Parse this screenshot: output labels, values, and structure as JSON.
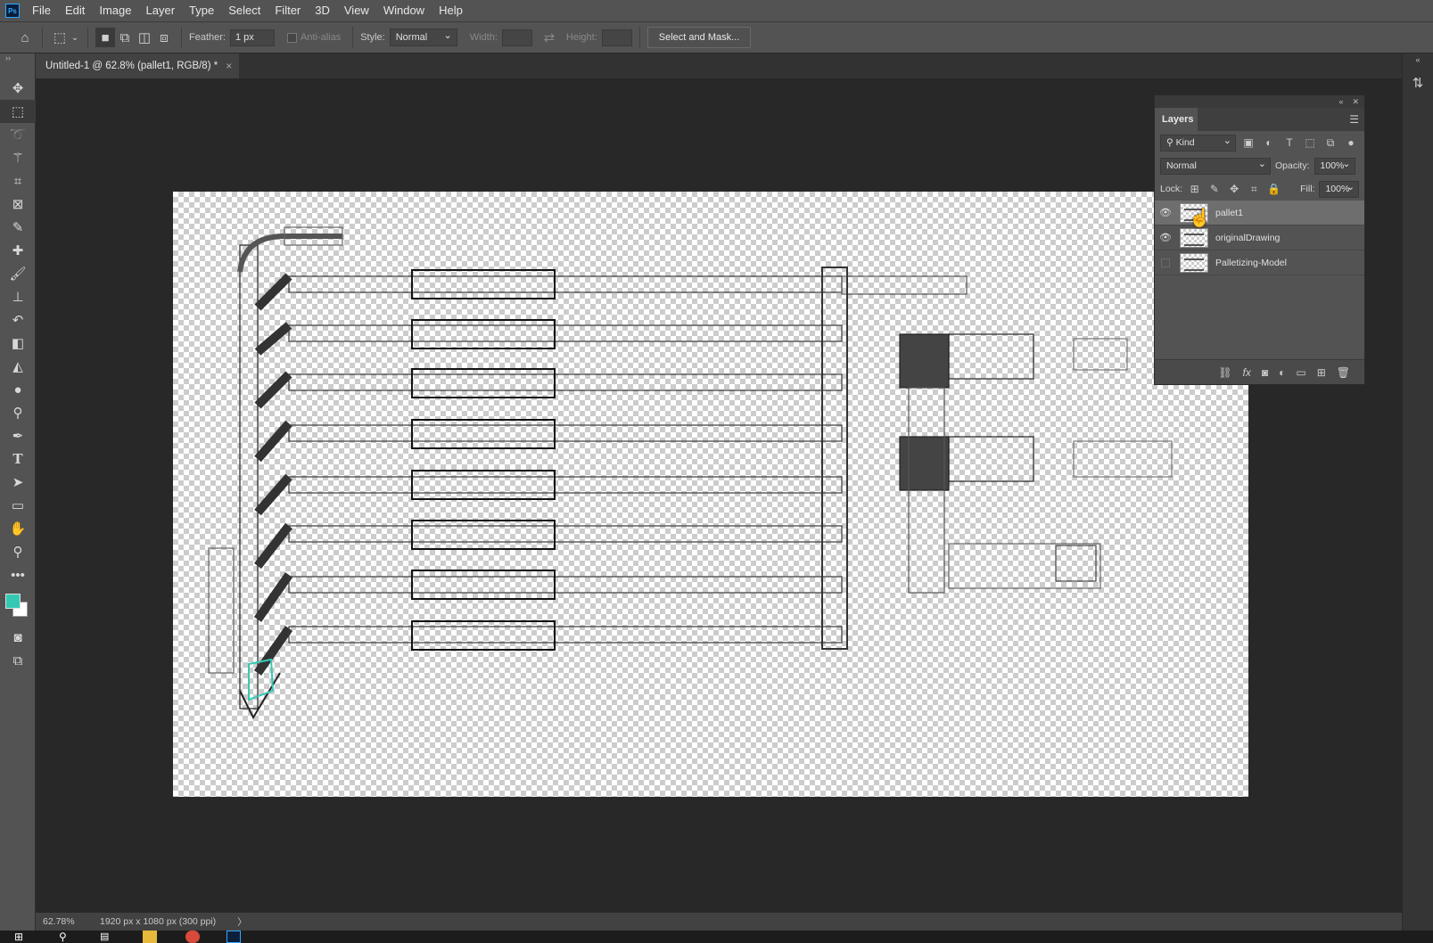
{
  "menubar": {
    "items": [
      "File",
      "Edit",
      "Image",
      "Layer",
      "Type",
      "Select",
      "Filter",
      "3D",
      "View",
      "Window",
      "Help"
    ]
  },
  "options": {
    "feather_label": "Feather:",
    "feather_value": "1 px",
    "antialias_label": "Anti-alias",
    "style_label": "Style:",
    "style_value": "Normal",
    "width_label": "Width:",
    "height_label": "Height:",
    "select_mask_label": "Select and Mask..."
  },
  "document": {
    "tab_title": "Untitled-1 @ 62.8% (pallet1, RGB/8) *",
    "close": "×"
  },
  "status": {
    "zoom": "62.78%",
    "info": "1920 px x 1080 px (300 ppi)",
    "arrow": "〉"
  },
  "layers_panel": {
    "tab": "Layers",
    "filter_kind": "Kind",
    "blend_mode": "Normal",
    "opacity_label": "Opacity:",
    "opacity_value": "100%",
    "lock_label": "Lock:",
    "fill_label": "Fill:",
    "fill_value": "100%",
    "layers": [
      {
        "name": "pallet1",
        "visible": true,
        "selected": true
      },
      {
        "name": "originalDrawing",
        "visible": true,
        "selected": false
      },
      {
        "name": "Palletizing-Model",
        "visible": false,
        "selected": false
      }
    ]
  },
  "colors": {
    "foreground": "#35c9b4",
    "background": "#ffffff",
    "ps_accent": "#31a8ff"
  },
  "tools": [
    "move-icon",
    "marquee-icon",
    "lasso-icon",
    "magic-wand-icon",
    "crop-icon",
    "frame-icon",
    "eyedropper-icon",
    "healing-icon",
    "brush-icon",
    "stamp-icon",
    "history-brush-icon",
    "eraser-icon",
    "paint-bucket-icon",
    "blur-icon",
    "dodge-icon",
    "pen-icon",
    "type-icon",
    "path-select-icon",
    "rectangle-icon",
    "hand-icon",
    "zoom-icon",
    "more-icon"
  ]
}
